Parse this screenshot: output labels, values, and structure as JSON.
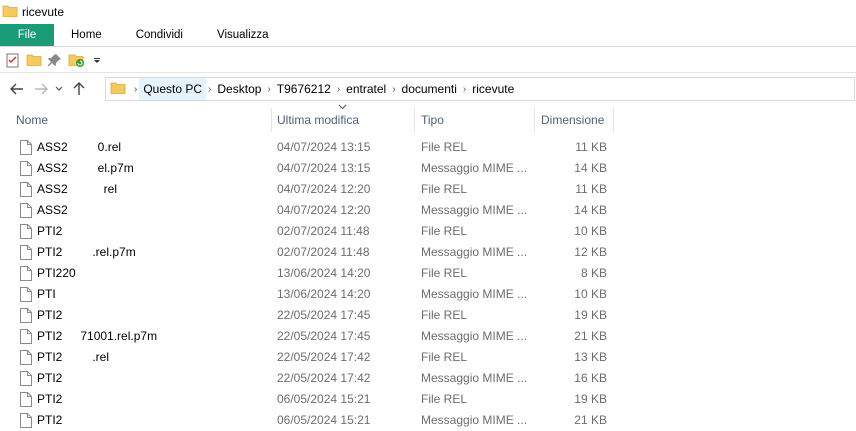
{
  "window": {
    "title": "ricevute"
  },
  "ribbon": {
    "tabs": [
      {
        "label": "File"
      },
      {
        "label": "Home"
      },
      {
        "label": "Condividi"
      },
      {
        "label": "Visualizza"
      }
    ]
  },
  "quick_access": {
    "icons": [
      "properties-icon",
      "new-folder-icon",
      "pin-icon",
      "undo-icon",
      "customize-dropdown-icon"
    ]
  },
  "nav": {
    "back": "back-arrow-icon",
    "forward": "forward-arrow-icon",
    "recent": "recent-locations-icon",
    "up": "up-arrow-icon"
  },
  "address": {
    "crumbs": [
      {
        "label": "Questo PC"
      },
      {
        "label": "Desktop"
      },
      {
        "label": "T9676212"
      },
      {
        "label": "entratel"
      },
      {
        "label": "documenti"
      },
      {
        "label": "ricevute"
      }
    ]
  },
  "columns": {
    "name": "Nome",
    "modified": "Ultima modifica",
    "type": "Tipo",
    "size": "Dimensione"
  },
  "files": [
    {
      "name": "ASS2     0.rel",
      "modified": "04/07/2024 13:15",
      "type": "File REL",
      "size": "11 KB"
    },
    {
      "name": "ASS2     el.p7m",
      "modified": "04/07/2024 13:15",
      "type": "Messaggio MIME ...",
      "size": "14 KB"
    },
    {
      "name": "ASS2      rel",
      "modified": "04/07/2024 12:20",
      "type": "File REL",
      "size": "11 KB"
    },
    {
      "name": "ASS2        ",
      "modified": "04/07/2024 12:20",
      "type": "Messaggio MIME ...",
      "size": "14 KB"
    },
    {
      "name": "PTI2      ",
      "modified": "02/07/2024 11:48",
      "type": "File REL",
      "size": "10 KB"
    },
    {
      "name": "PTI2     .rel.p7m",
      "modified": "02/07/2024 11:48",
      "type": "Messaggio MIME ...",
      "size": "12 KB"
    },
    {
      "name": "PTI220      ",
      "modified": "13/06/2024 14:20",
      "type": "File REL",
      "size": "8 KB"
    },
    {
      "name": "PTI       ",
      "modified": "13/06/2024 14:20",
      "type": "Messaggio MIME ...",
      "size": "10 KB"
    },
    {
      "name": "PTI2      ",
      "modified": "22/05/2024 17:45",
      "type": "File REL",
      "size": "19 KB"
    },
    {
      "name": "PTI2   71001.rel.p7m",
      "modified": "22/05/2024 17:45",
      "type": "Messaggio MIME ...",
      "size": "21 KB"
    },
    {
      "name": "PTI2     .rel",
      "modified": "22/05/2024 17:42",
      "type": "File REL",
      "size": "13 KB"
    },
    {
      "name": "PTI2      ",
      "modified": "22/05/2024 17:42",
      "type": "Messaggio MIME ...",
      "size": "16 KB"
    },
    {
      "name": "PTI2     ",
      "modified": "06/05/2024 15:21",
      "type": "File REL",
      "size": "19 KB"
    },
    {
      "name": "PTI2      ",
      "modified": "06/05/2024 15:21",
      "type": "Messaggio MIME ...",
      "size": "21 KB"
    }
  ]
}
